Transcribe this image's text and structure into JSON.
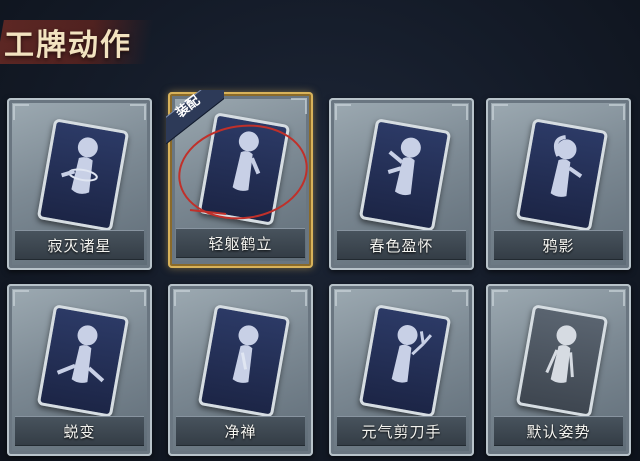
{
  "header": {
    "title": "工牌动作"
  },
  "badge_text": "装配",
  "colors": {
    "accent_gold": "#d8b25a",
    "title_bar": "#6a2a24",
    "annotation": "#c0302a"
  },
  "cards": [
    {
      "label": "寂灭诸星",
      "equipped": false,
      "icon": "silhouette-pose-icon"
    },
    {
      "label": "轻躯鹤立",
      "equipped": true,
      "icon": "silhouette-pose-icon"
    },
    {
      "label": "春色盈怀",
      "equipped": false,
      "icon": "silhouette-pose-icon"
    },
    {
      "label": "鸦影",
      "equipped": false,
      "icon": "silhouette-pose-icon"
    },
    {
      "label": "蜕变",
      "equipped": false,
      "icon": "silhouette-pose-icon"
    },
    {
      "label": "净禅",
      "equipped": false,
      "icon": "silhouette-pose-icon"
    },
    {
      "label": "元气剪刀手",
      "equipped": false,
      "icon": "silhouette-pose-icon"
    },
    {
      "label": "默认姿势",
      "equipped": false,
      "icon": "silhouette-pose-icon"
    }
  ]
}
